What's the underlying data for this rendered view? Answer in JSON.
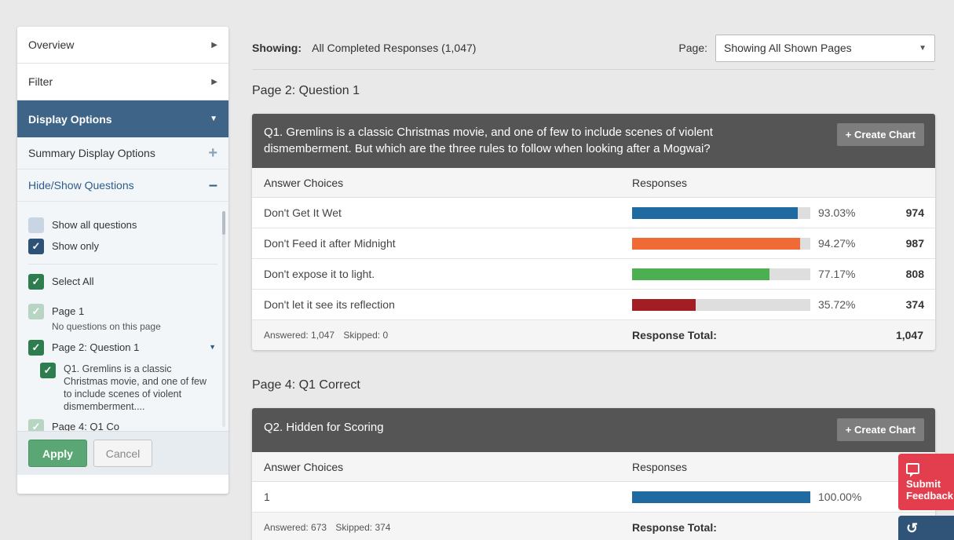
{
  "sidebar": {
    "overview_label": "Overview",
    "filter_label": "Filter",
    "display_options_label": "Display Options",
    "summary_display_options_label": "Summary Display Options",
    "hide_show_questions_label": "Hide/Show Questions",
    "show_all_questions_label": "Show all questions",
    "show_only_label": "Show only",
    "select_all_label": "Select All",
    "page1_label": "Page 1",
    "page1_note": "No questions on this page",
    "page2_label": "Page 2: Question 1",
    "q1_label": "Q1. Gremlins is a classic Christmas movie, and one of few to include scenes of violent dismemberment....",
    "partial_label": "Page 4: Q1 Co",
    "apply_label": "Apply",
    "cancel_label": "Cancel"
  },
  "toolbar": {
    "showing_label": "Showing:",
    "showing_value": "All Completed Responses (1,047)",
    "page_label": "Page:",
    "page_select_value": "Showing All Shown Pages"
  },
  "section1": {
    "title": "Page 2: Question 1",
    "question": "Q1. Gremlins is a classic Christmas movie, and one of few to include scenes of violent dismemberment. But which are the three rules to follow when looking after a Mogwai?",
    "create_chart_label": "+ Create Chart",
    "col_answer": "Answer Choices",
    "col_responses": "Responses",
    "rows": [
      {
        "label": "Don't Get It Wet",
        "pct": "93.03%",
        "fraction": 0.9303,
        "count": "974",
        "color": "#1f6aa0"
      },
      {
        "label": "Don't Feed it after Midnight",
        "pct": "94.27%",
        "fraction": 0.9427,
        "count": "987",
        "color": "#f06a35"
      },
      {
        "label": "Don't expose it to light.",
        "pct": "77.17%",
        "fraction": 0.7717,
        "count": "808",
        "color": "#4caf50"
      },
      {
        "label": "Don't let it see its reflection",
        "pct": "35.72%",
        "fraction": 0.3572,
        "count": "374",
        "color": "#a31e22"
      }
    ],
    "answered": "Answered: 1,047",
    "skipped": "Skipped: 0",
    "response_total_label": "Response Total:",
    "response_total_value": "1,047"
  },
  "section2": {
    "title": "Page 4: Q1 Correct",
    "question": "Q2. Hidden for Scoring",
    "create_chart_label": "+ Create Chart",
    "col_answer": "Answer Choices",
    "col_responses": "Responses",
    "rows": [
      {
        "label": "1",
        "pct": "100.00%",
        "fraction": 1.0,
        "count": "",
        "color": "#1f6aa0"
      }
    ],
    "answered": "Answered: 673",
    "skipped": "Skipped: 374",
    "response_total_label": "Response Total:"
  },
  "feedback": {
    "submit_line1": "Submit",
    "submit_line2": "Feedback"
  },
  "icons": {
    "chevron_right": "chevron-right-icon",
    "chevron_down": "chevron-down-icon",
    "plus": "plus-icon",
    "minus": "minus-icon",
    "check": "check-icon",
    "chat": "chat-icon",
    "undo": "undo-icon"
  }
}
